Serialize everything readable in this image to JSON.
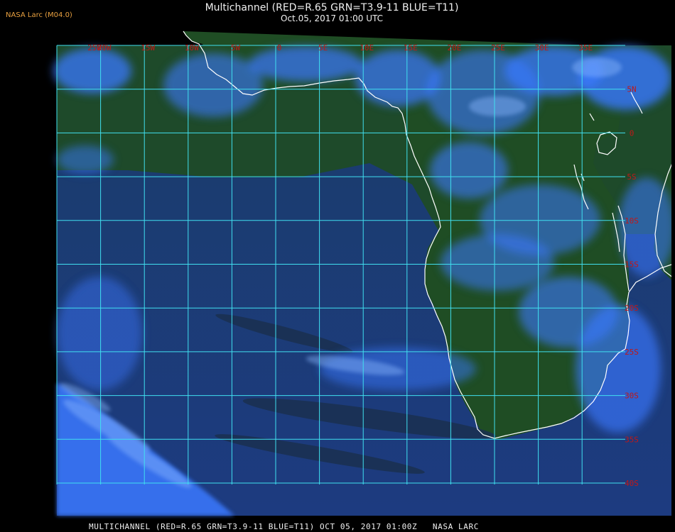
{
  "header": {
    "credit": "NASA Larc (M04.0)",
    "title": "Multichannel (RED=R.65 GRN=T3.9-11 BLUE=T11)",
    "datetime": "Oct.05, 2017 01:00 UTC"
  },
  "footer": {
    "caption": "MULTICHANNEL (RED=R.65 GRN=T3.9-11 BLUE=T11) OCT 05, 2017 01:00Z   NASA LARC"
  },
  "map": {
    "longitude_labels": [
      "25W",
      "20W",
      "15W",
      "10W",
      "5W",
      "0",
      "5E",
      "10E",
      "15E",
      "20E",
      "25E",
      "30E",
      "35E"
    ],
    "latitude_labels": [
      "5N",
      "0",
      "5S",
      "10S",
      "15S",
      "20S",
      "25S",
      "30S",
      "35S",
      "40S"
    ],
    "colors": {
      "grid": "#40e0f0",
      "label": "#c01818",
      "coast": "#ffffff",
      "ocean": "#1c3a78",
      "land": "#1f4a22",
      "cloud": "#3a78ff",
      "thin_cloud": "#8ab8ff"
    }
  }
}
